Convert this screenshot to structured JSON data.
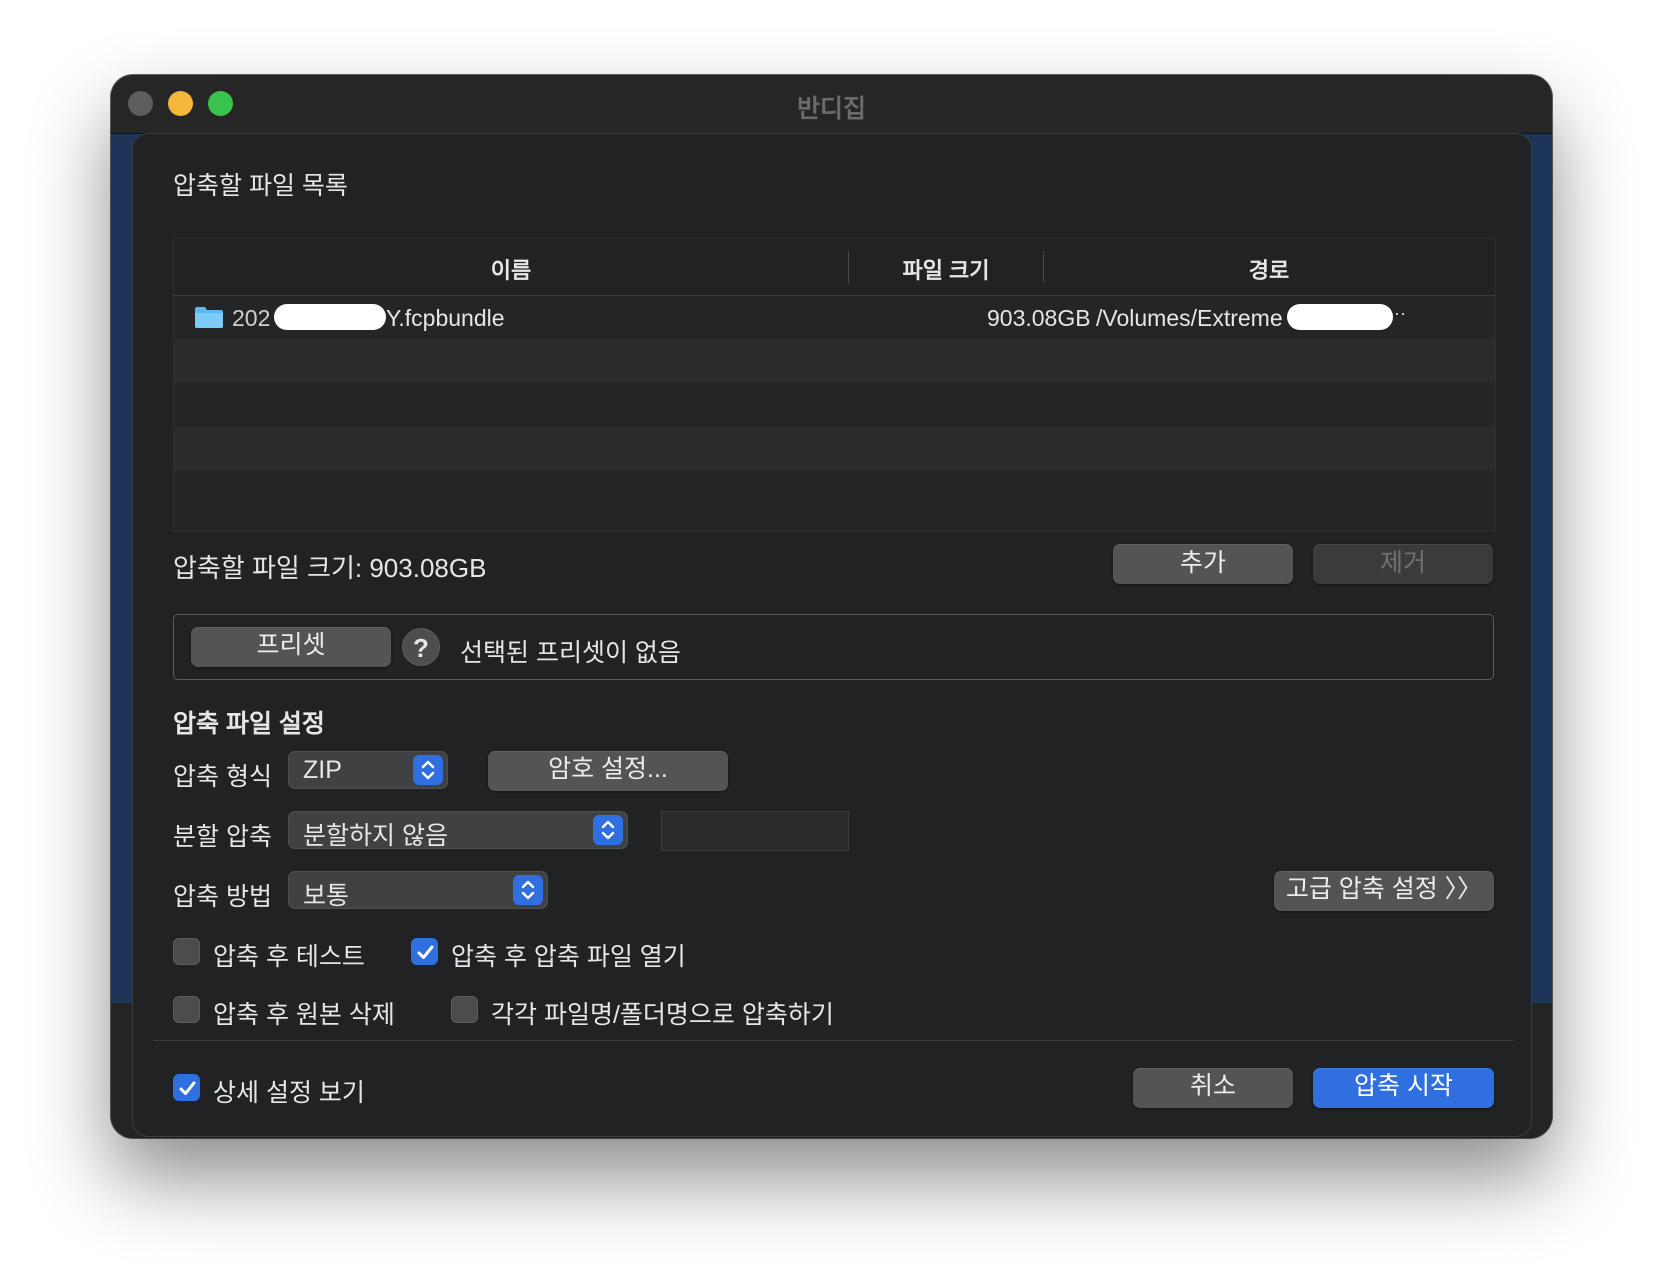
{
  "window": {
    "title": "반디집"
  },
  "file_list": {
    "section_title": "압축할 파일 목록",
    "columns": [
      "이름",
      "파일 크기",
      "경로"
    ],
    "rows": [
      {
        "icon": "folder-icon",
        "name_visible": "Y.fcpbundle",
        "name_prefix": "202",
        "size": "903.08GB",
        "path": "/Volumes/Extreme SSD/",
        "path_tail": "··"
      }
    ]
  },
  "summary": {
    "total_size_label": "압축할 파일 크기: 903.08GB",
    "add_label": "추가",
    "remove_label": "제거"
  },
  "preset": {
    "button_label": "프리셋",
    "help_label": "?",
    "status": "선택된 프리셋이 없음"
  },
  "settings": {
    "section_title": "압축 파일 설정",
    "format_label": "압축 형식",
    "format_value": "ZIP",
    "password_button": "암호 설정...",
    "split_label": "분할 압축",
    "split_value": "분할하지 않음",
    "method_label": "압축 방법",
    "method_value": "보통",
    "advanced_button": "고급 압축 설정 〉〉"
  },
  "options": {
    "test_after": {
      "label": "압축 후 테스트",
      "checked": false
    },
    "open_after": {
      "label": "압축 후 압축 파일 열기",
      "checked": true
    },
    "delete_original": {
      "label": "압축 후 원본 삭제",
      "checked": false
    },
    "each_file": {
      "label": "각각 파일명/폴더명으로 압축하기",
      "checked": false
    }
  },
  "footer": {
    "details": {
      "label": "상세 설정 보기",
      "checked": true
    },
    "cancel_label": "취소",
    "start_label": "압축 시작"
  },
  "colors": {
    "accent": "#2f6fe0",
    "sheet_bg": "#212223",
    "button_bg": "#525456"
  }
}
